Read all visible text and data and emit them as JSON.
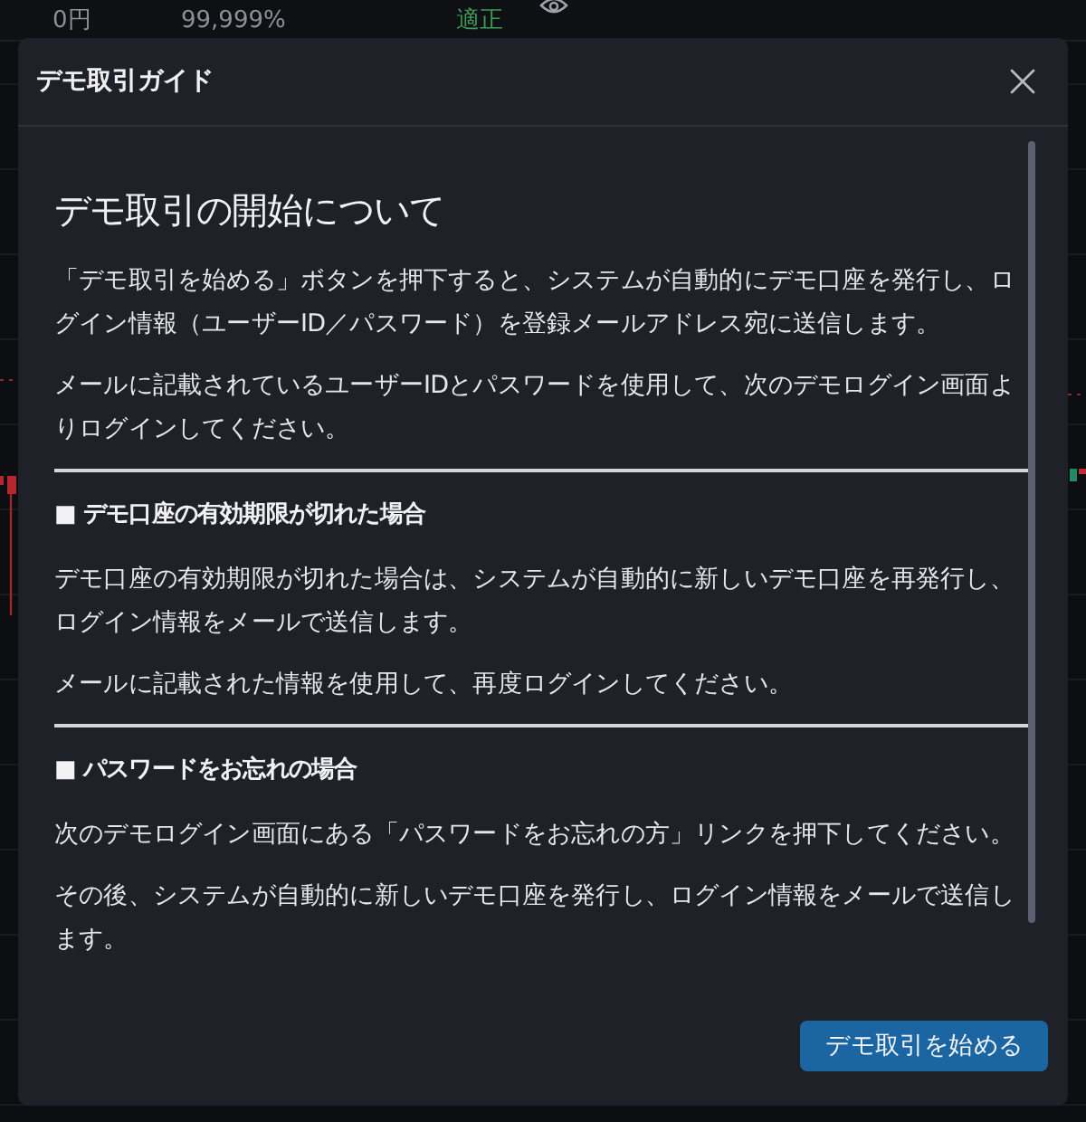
{
  "background": {
    "stats": [
      {
        "kind": "amount",
        "text": "0円"
      },
      {
        "kind": "ratio",
        "text": "99,999%"
      },
      {
        "kind": "status",
        "text": "適正"
      }
    ]
  },
  "dialog": {
    "title": "デモ取引ガイド",
    "heading": "デモ取引の開始について",
    "intro": [
      "「デモ取引を始める」ボタンを押下すると、システムが自動的にデモ口座を発行し、ログイン情報（ユーザーID／パスワード）を登録メールアドレス宛に送信します。",
      "メールに記載されているユーザーIDとパスワードを使用して、次のデモログイン画面よりログインしてください。"
    ],
    "sections": [
      {
        "heading": "■ デモ口座の有効期限が切れた場合",
        "paragraphs": [
          "デモ口座の有効期限が切れた場合は、システムが自動的に新しいデモ口座を再発行し、ログイン情報をメールで送信します。",
          "メールに記載された情報を使用して、再度ログインしてください。"
        ]
      },
      {
        "heading": "■ パスワードをお忘れの場合",
        "paragraphs": [
          "次のデモログイン画面にある「パスワードをお忘れの方」リンクを押下してください。",
          "その後、システムが自動的に新しいデモ口座を発行し、ログイン情報をメールで送信します。"
        ]
      }
    ],
    "button": "デモ取引を始める"
  }
}
